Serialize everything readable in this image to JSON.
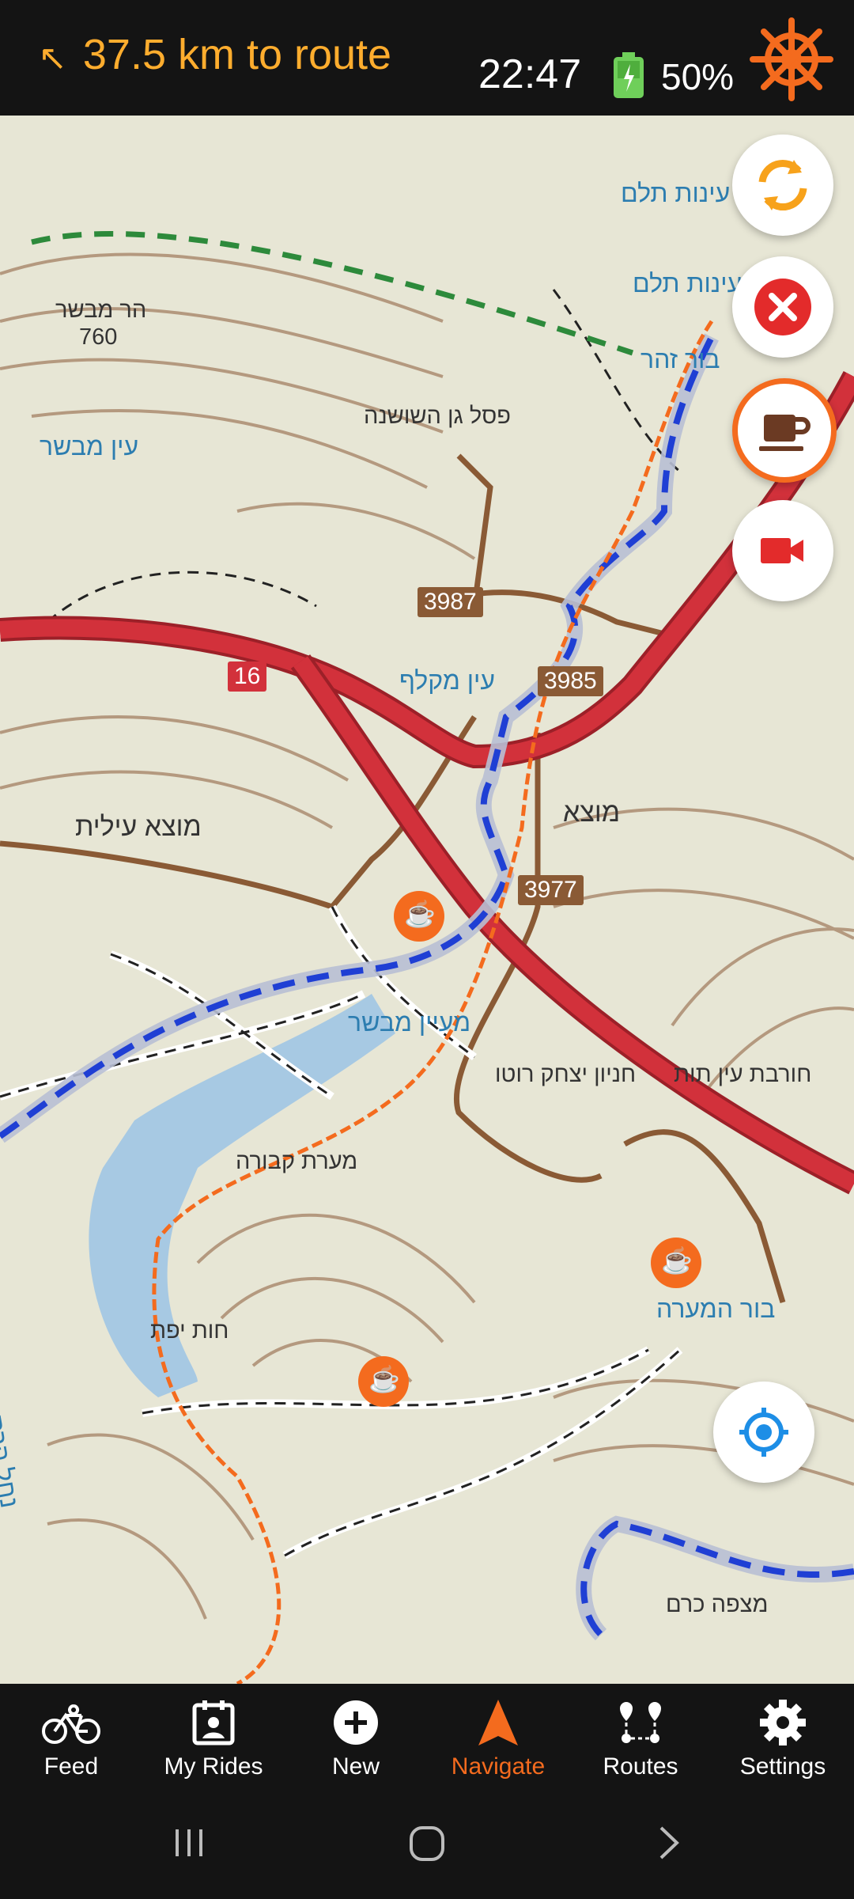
{
  "status": {
    "route_distance": "37.5 km to route",
    "time": "22:47",
    "battery": "50%"
  },
  "map": {
    "labels": [
      {
        "id": "har-mevaser",
        "text": "הר מבשר"
      },
      {
        "id": "har-mevaser-elev",
        "text": "760"
      },
      {
        "id": "ein-mevaser",
        "text": "עין מבשר"
      },
      {
        "id": "pesel",
        "text": "פסל גן השושנה"
      },
      {
        "id": "ein-teilim-1",
        "text": "עינות תלם"
      },
      {
        "id": "ein-teilim-2",
        "text": "עינות תלם"
      },
      {
        "id": "bor-zohar",
        "text": "בור זהר"
      },
      {
        "id": "ein-maklef",
        "text": "עין מקלף"
      },
      {
        "id": "motza-ilit",
        "text": "מוצא עילית"
      },
      {
        "id": "motza",
        "text": "מוצא"
      },
      {
        "id": "maayan-mevaser",
        "text": "מעיין מבשר"
      },
      {
        "id": "hanyon",
        "text": "חניון יצחק רוטו"
      },
      {
        "id": "hurvat-ein",
        "text": "חורבת עין תות"
      },
      {
        "id": "mearat-kvura",
        "text": "מערת קבורה"
      },
      {
        "id": "hot-yafat",
        "text": "חות יפת"
      },
      {
        "id": "bor-hamaara",
        "text": "בור המערה"
      },
      {
        "id": "mitzpe-kerem",
        "text": "מצפה כרם"
      },
      {
        "id": "nahal-harat",
        "text": "נחל הרת"
      }
    ],
    "road_numbers": [
      "3987",
      "3985",
      "3977",
      "16"
    ]
  },
  "nav": {
    "items": [
      {
        "label": "Feed",
        "icon": "bike-icon"
      },
      {
        "label": "My Rides",
        "icon": "calendar-icon"
      },
      {
        "label": "New",
        "icon": "plus-circle-icon"
      },
      {
        "label": "Navigate",
        "icon": "navigation-arrow-icon"
      },
      {
        "label": "Routes",
        "icon": "routes-icon"
      },
      {
        "label": "Settings",
        "icon": "gear-icon"
      }
    ],
    "active": "Navigate"
  },
  "colors": {
    "accent": "#f46b1e",
    "route_distance": "#ffad2e",
    "map_bg": "#e7e6d5",
    "highway": "#d2313b",
    "contour": "#8a5a35"
  }
}
